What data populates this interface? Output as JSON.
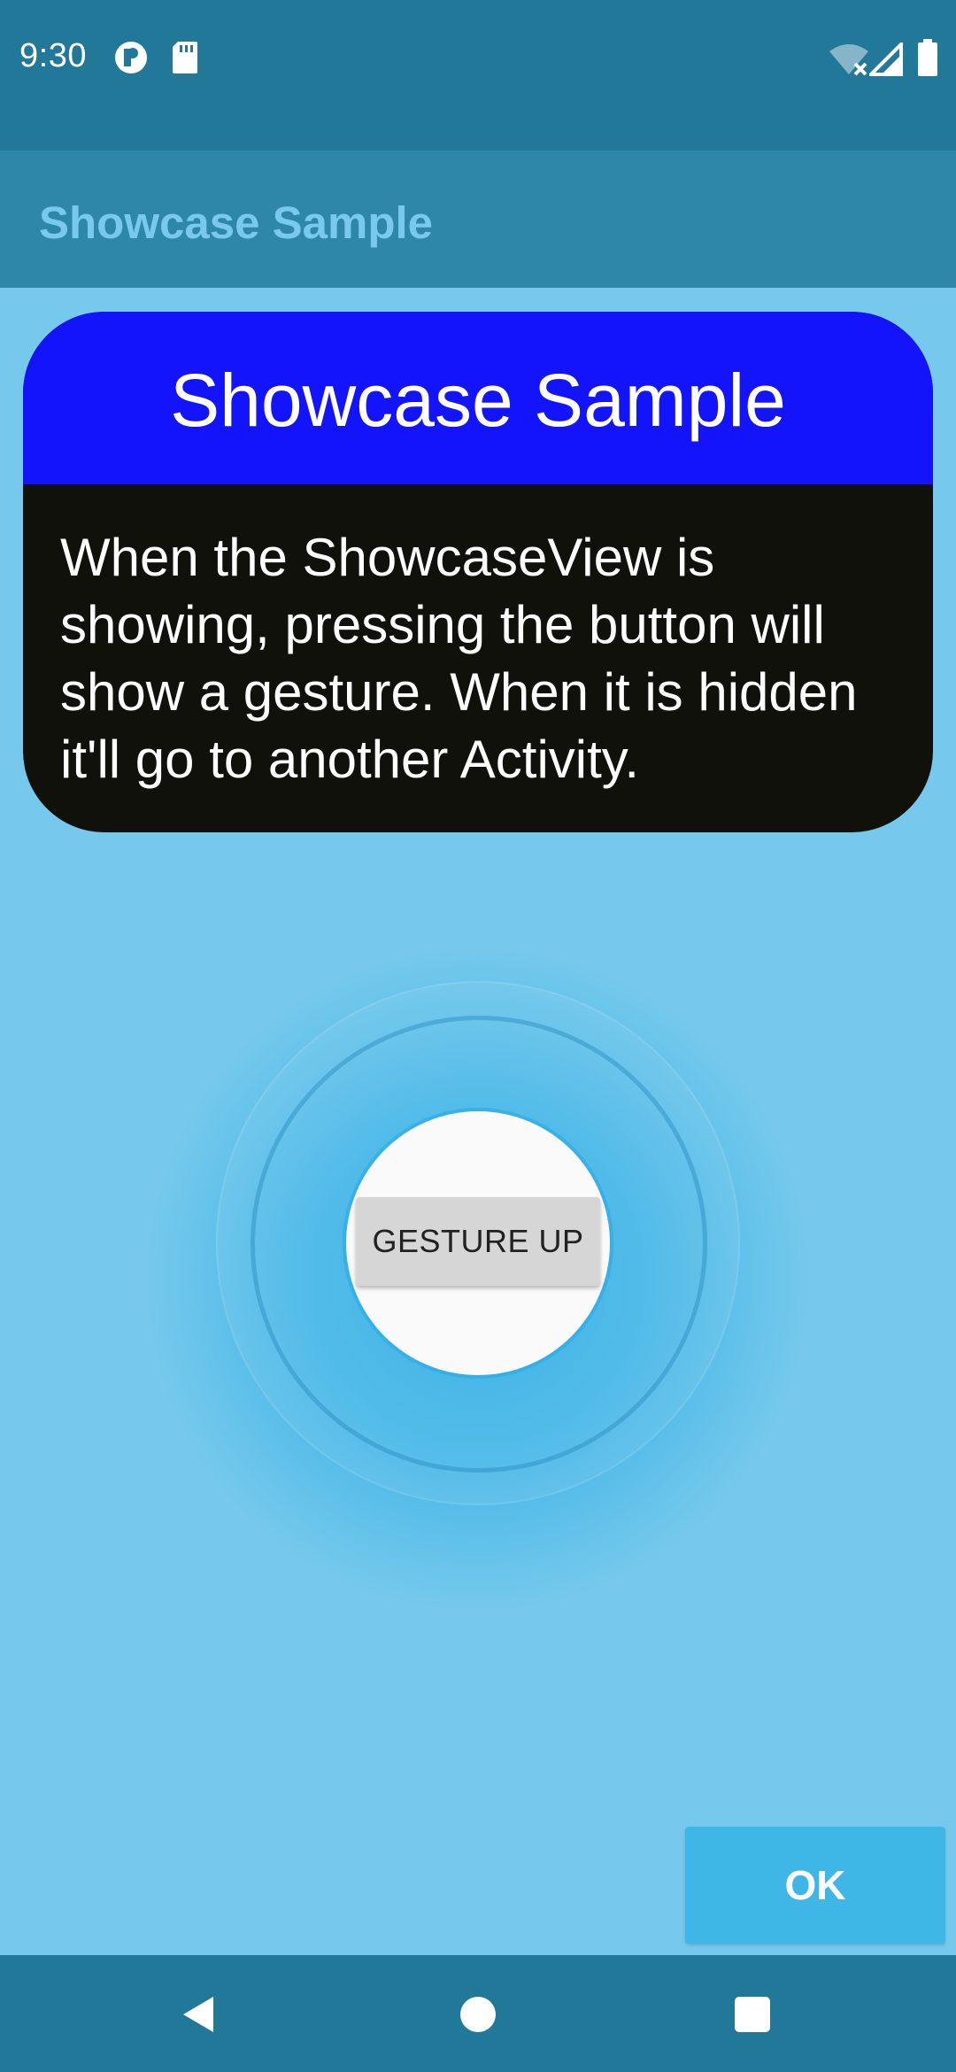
{
  "status_bar": {
    "time": "9:30",
    "icons_left": [
      "notification-icon",
      "sd-card-icon"
    ],
    "icons_right": [
      "wifi-off-icon",
      "signal-icon",
      "battery-icon"
    ]
  },
  "app_bar": {
    "title": "Showcase Sample"
  },
  "showcase": {
    "title": "Showcase Sample",
    "text": "When the ShowcaseView is showing, pressing the button will show a gesture. When it is hidden it'll go to another Activity."
  },
  "target": {
    "button_label": "GESTURE UP"
  },
  "ok_button": {
    "label": "OK"
  },
  "nav_bar": {
    "icons": [
      "back-icon",
      "home-icon",
      "recents-icon"
    ]
  },
  "colors": {
    "status_bar": "#227899",
    "app_bar": "#2e86a8",
    "overlay": "#76c9ec",
    "card_header": "#1314fc",
    "card_body": "#10110a",
    "ok_button": "#3fb7e6"
  }
}
